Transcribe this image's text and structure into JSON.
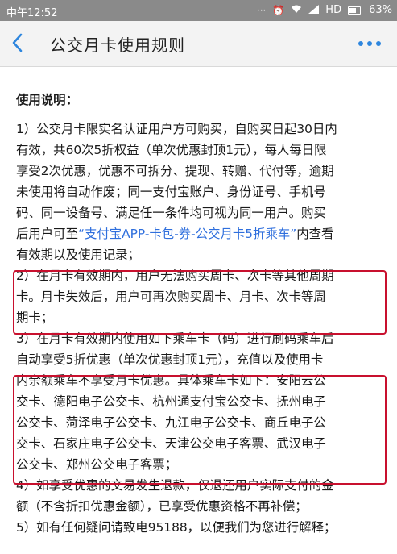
{
  "status_bar": {
    "time": "中午12:52",
    "network": "HD",
    "battery": "63%"
  },
  "nav": {
    "title": "公交月卡使用规则"
  },
  "content": {
    "section_title": "使用说明：",
    "lines": [
      "1）公交月卡限实名认证用户方可购买，自购买日起30日内",
      "有效，共60次5折权益（单次优惠封顶1元），每人每日限",
      "享受2次优惠，优惠不可拆分、提现、转赠、代付等，逾期",
      "未使用将自动作废；同一支付宝账户、身份证号、手机号",
      "码、同一设备号、满足任一条件均可视为同一用户。购买",
      "后用户可至",
      "有效期以及使用记录；",
      "2）在月卡有效期内，用户无法购买周卡、次卡等其他周期",
      "卡。月卡失效后，用户可再次购买周卡、月卡、次卡等周",
      "期卡；",
      "3）在月卡有效期内使用如下乘车卡（码）进行刷码乘车后",
      "自动享受5折优惠（单次优惠封顶1元），充值以及使用卡",
      "内余额乘车不享受月卡优惠。具体乘车卡如下：安阳云公",
      "交卡、德阳电子公交卡、杭州通支付宝公交卡、抚州电子",
      "公交卡、菏泽电子公交卡、九江电子公交卡、商丘电子公",
      "交卡、石家庄电子公交卡、天津公交电子客票、武汉电子",
      "公交卡、郑州公交电子客票；",
      "4）如享受优惠的交易发生退款，仅退还用户实际支付的金",
      "额（不含折扣优惠金额），已享受优惠资格不再补偿；",
      "5）如有任何疑问请致电95188，以便我们为您进行解释；"
    ],
    "link_text": "“支付宝APP-卡包-券-公交月卡5折乘车”",
    "after_link": "内查看"
  }
}
